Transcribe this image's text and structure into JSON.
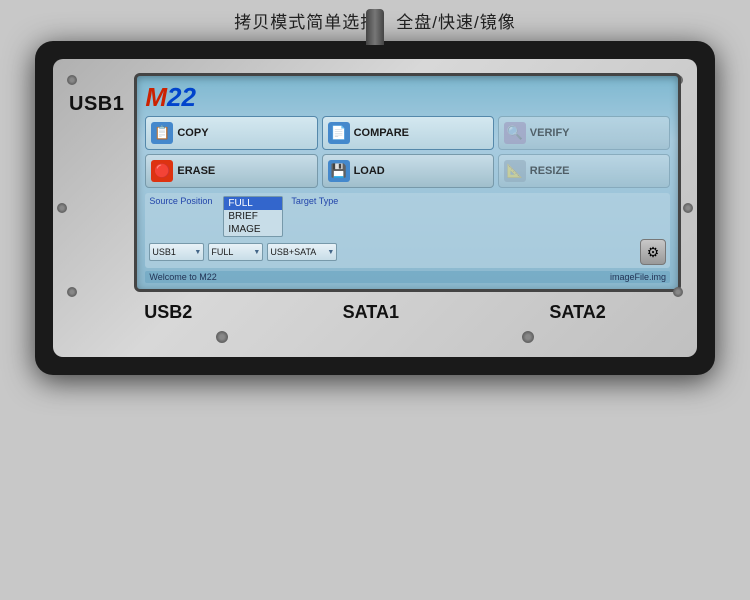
{
  "page": {
    "top_label": "拷贝模式简单选择：全盘/快速/镜像",
    "logo": "M22",
    "logo_m": "M",
    "logo_22": "22",
    "buttons": [
      {
        "id": "copy",
        "label": "COPY",
        "icon_type": "copy",
        "disabled": false
      },
      {
        "id": "compare",
        "label": "COMPARE",
        "icon_type": "compare",
        "disabled": false
      },
      {
        "id": "verify",
        "label": "VERIFY",
        "icon_type": "verify",
        "disabled": true
      },
      {
        "id": "erase",
        "label": "ERASE",
        "icon_type": "erase",
        "disabled": false
      },
      {
        "id": "load",
        "label": "LOAD",
        "icon_type": "load",
        "disabled": false
      },
      {
        "id": "resize",
        "label": "RESIZE",
        "icon_type": "resize",
        "disabled": true
      }
    ],
    "source_position_label": "Source Position",
    "dropdown_popup": [
      {
        "label": "FULL",
        "selected": true
      },
      {
        "label": "BRIEF",
        "selected": false
      },
      {
        "label": "IMAGE",
        "selected": false
      }
    ],
    "target_type_label": "Target Type",
    "source_select": {
      "value": "USB1",
      "arrow": "▼"
    },
    "mode_select": {
      "value": "FULL",
      "arrow": "▼"
    },
    "target_select": {
      "value": "USB+SATA",
      "arrow": "▼"
    },
    "status_left": "Welcome to M22",
    "status_right": "imageFile.img",
    "settings_icon": "⚙",
    "port_labels": [
      "USB2",
      "SATA1",
      "SATA2"
    ],
    "usb1_label": "USB1",
    "cable_visible": true
  }
}
